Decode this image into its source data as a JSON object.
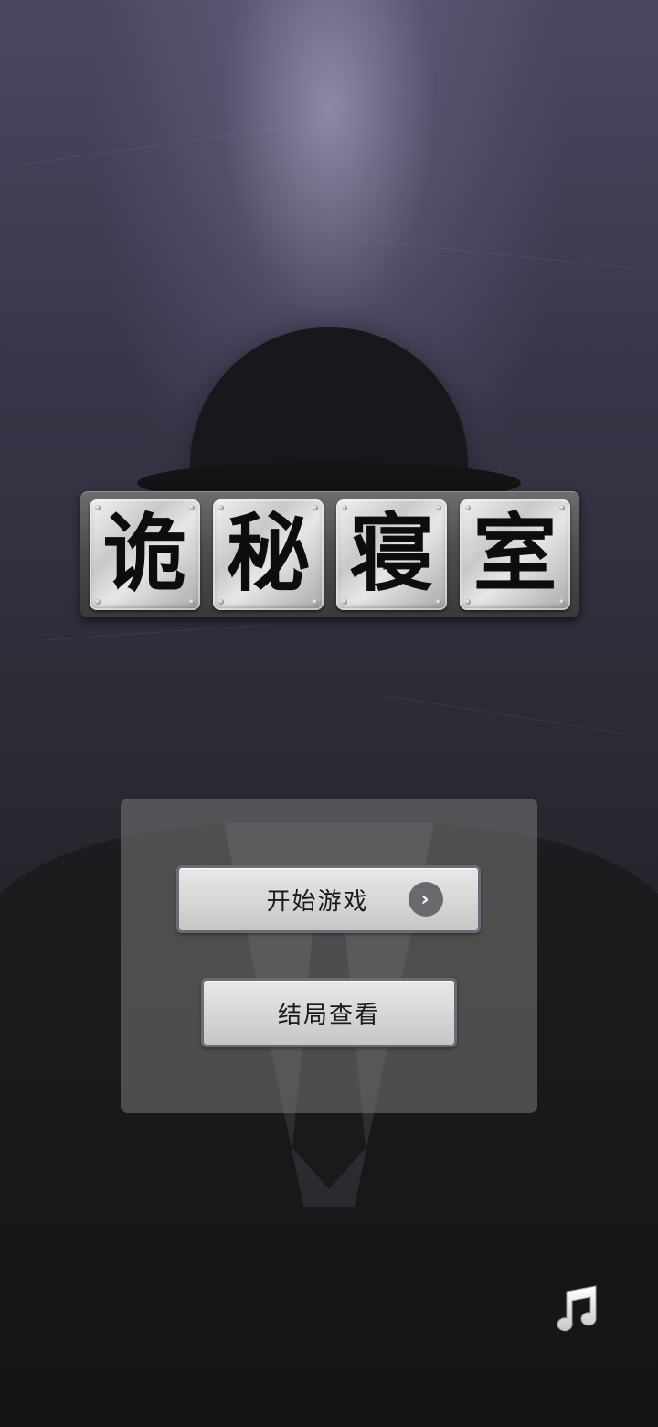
{
  "title": {
    "chars": [
      "诡",
      "秘",
      "寝",
      "室"
    ]
  },
  "menu": {
    "start_label": "开始游戏",
    "ending_label": "结局查看"
  },
  "icons": {
    "start_arrow": "chevron-right-icon",
    "music": "music-note-icon"
  },
  "colors": {
    "background_top": "#4a4860",
    "background_bottom": "#17171b",
    "panel": "#787878",
    "button_face": "#d8d8d8",
    "button_border": "#6c6a74",
    "title_tile": "#d0d0d0"
  }
}
